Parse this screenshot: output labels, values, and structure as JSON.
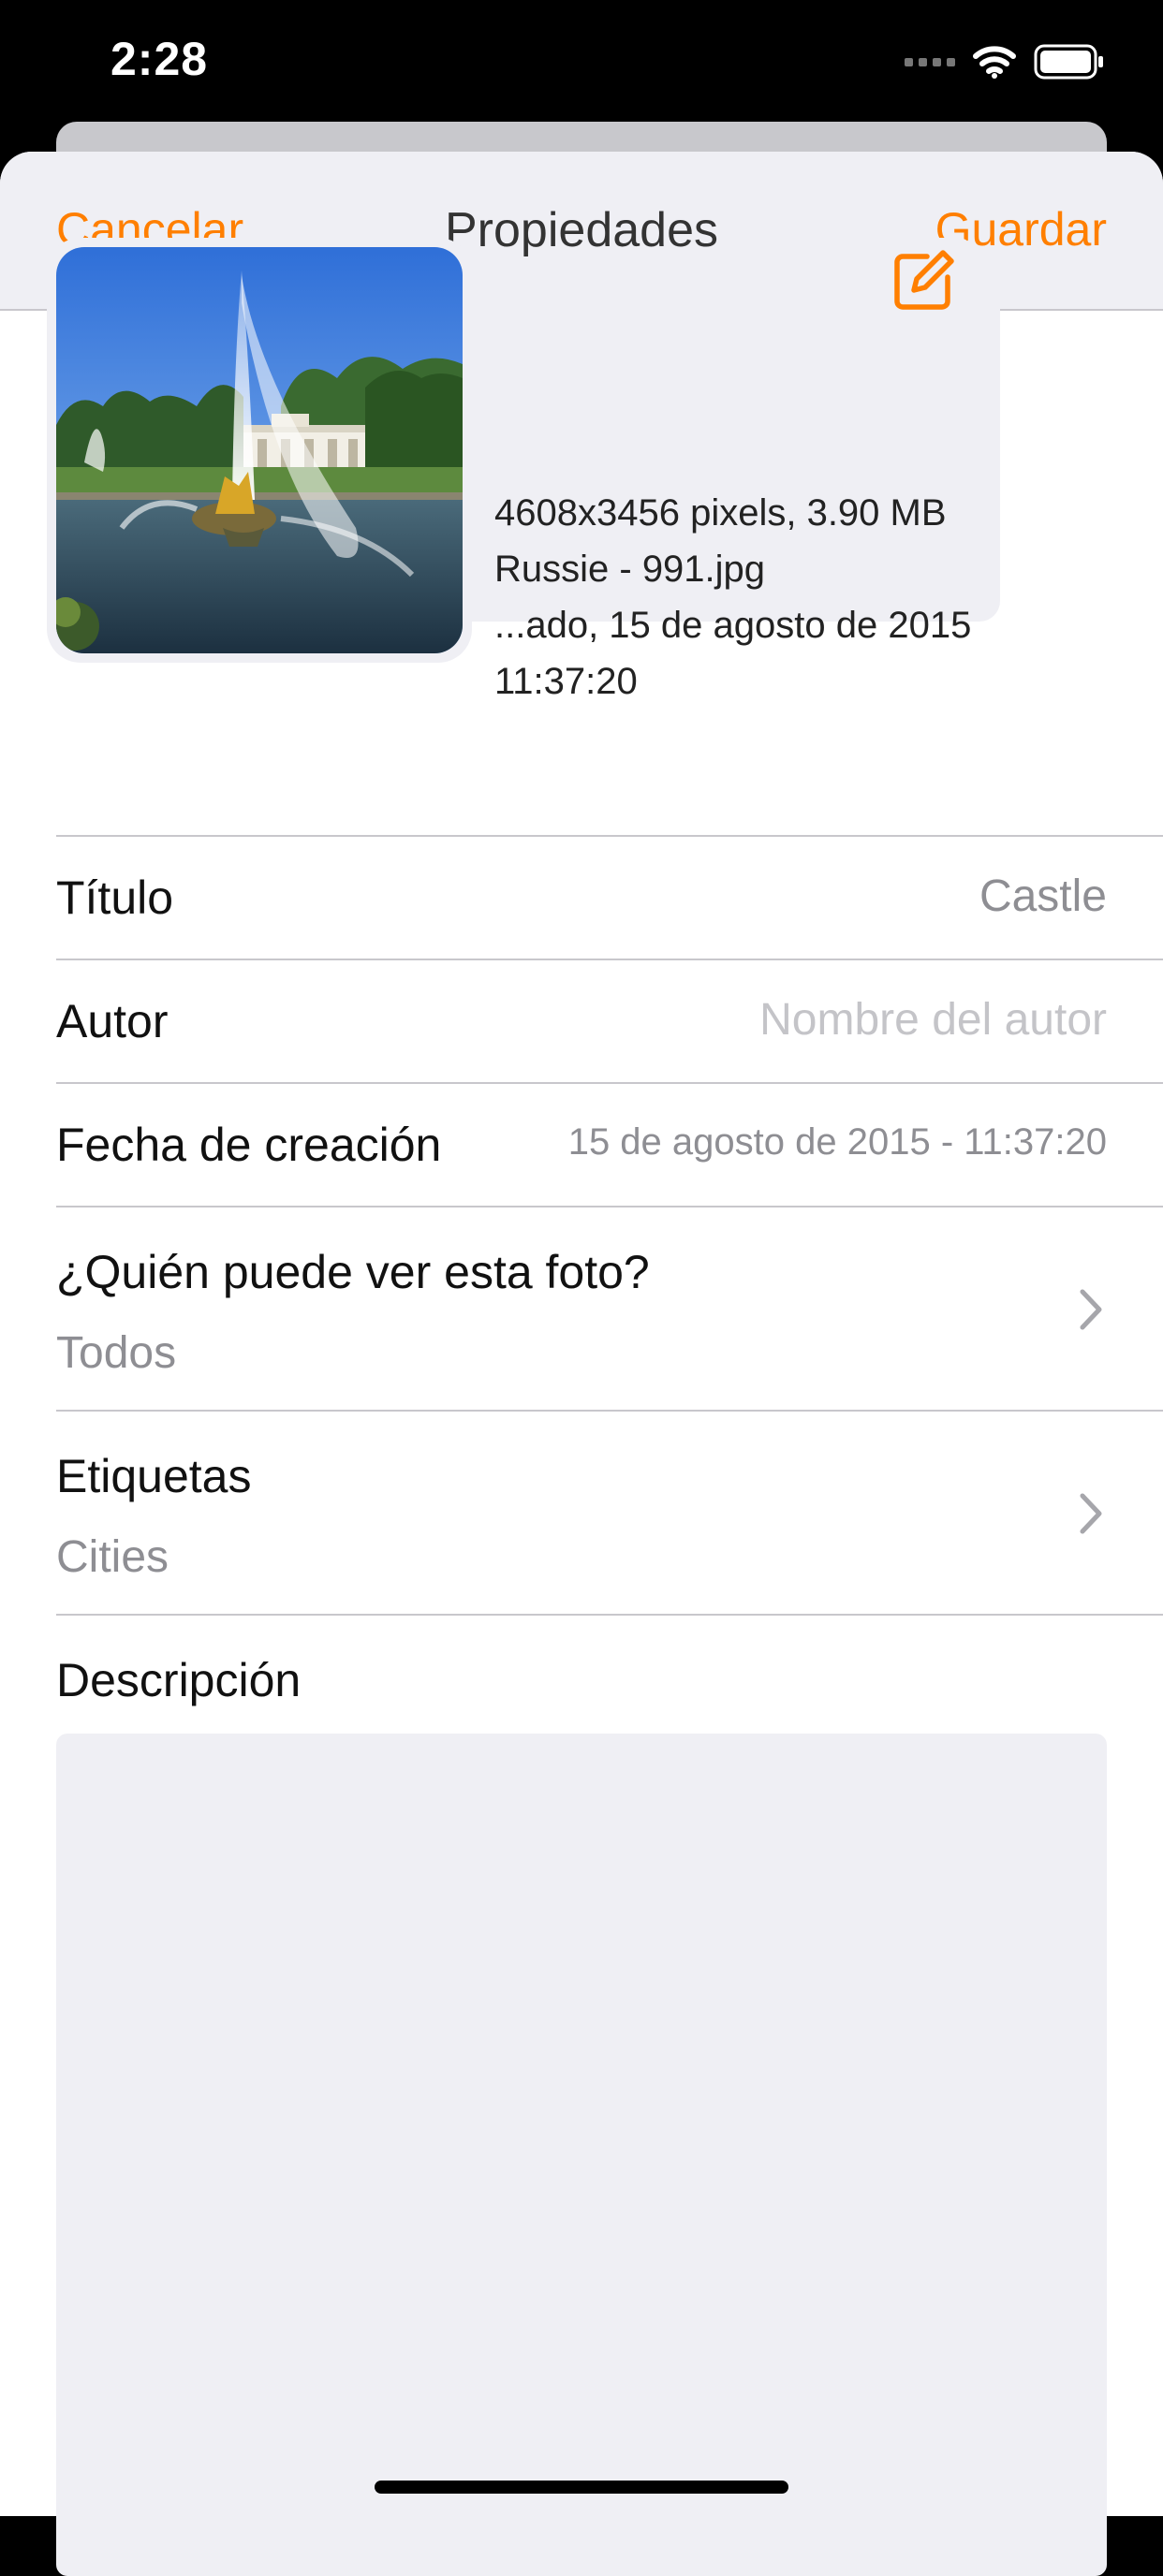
{
  "status_bar": {
    "time": "2:28"
  },
  "nav": {
    "cancel_label": "Cancelar",
    "title": "Propiedades",
    "save_label": "Guardar"
  },
  "photo_info": {
    "dimensions_size": "4608x3456 pixels, 3.90 MB",
    "filename": "Russie - 991.jpg",
    "date_line": "...ado, 15 de agosto de 2015",
    "time_line": "11:37:20"
  },
  "fields": {
    "title": {
      "label": "Título",
      "value": "Castle"
    },
    "author": {
      "label": "Autor",
      "placeholder": "Nombre del autor"
    },
    "creation_date": {
      "label": "Fecha de creación",
      "value": "15 de agosto de 2015 - 11:37:20"
    },
    "privacy": {
      "label": "¿Quién puede ver esta foto?",
      "value": "Todos"
    },
    "tags": {
      "label": "Etiquetas",
      "value": "Cities"
    },
    "description": {
      "label": "Descripción",
      "value": ""
    }
  },
  "colors": {
    "accent": "#ff7f00",
    "background_gray": "#efeff4",
    "separator": "#c8c7cc",
    "secondary_text": "#8e8e93"
  },
  "icons": {
    "edit": "edit-square-icon",
    "chevron": "chevron-right-icon",
    "wifi": "wifi-icon",
    "battery": "battery-icon",
    "signal": "signal-icon"
  }
}
